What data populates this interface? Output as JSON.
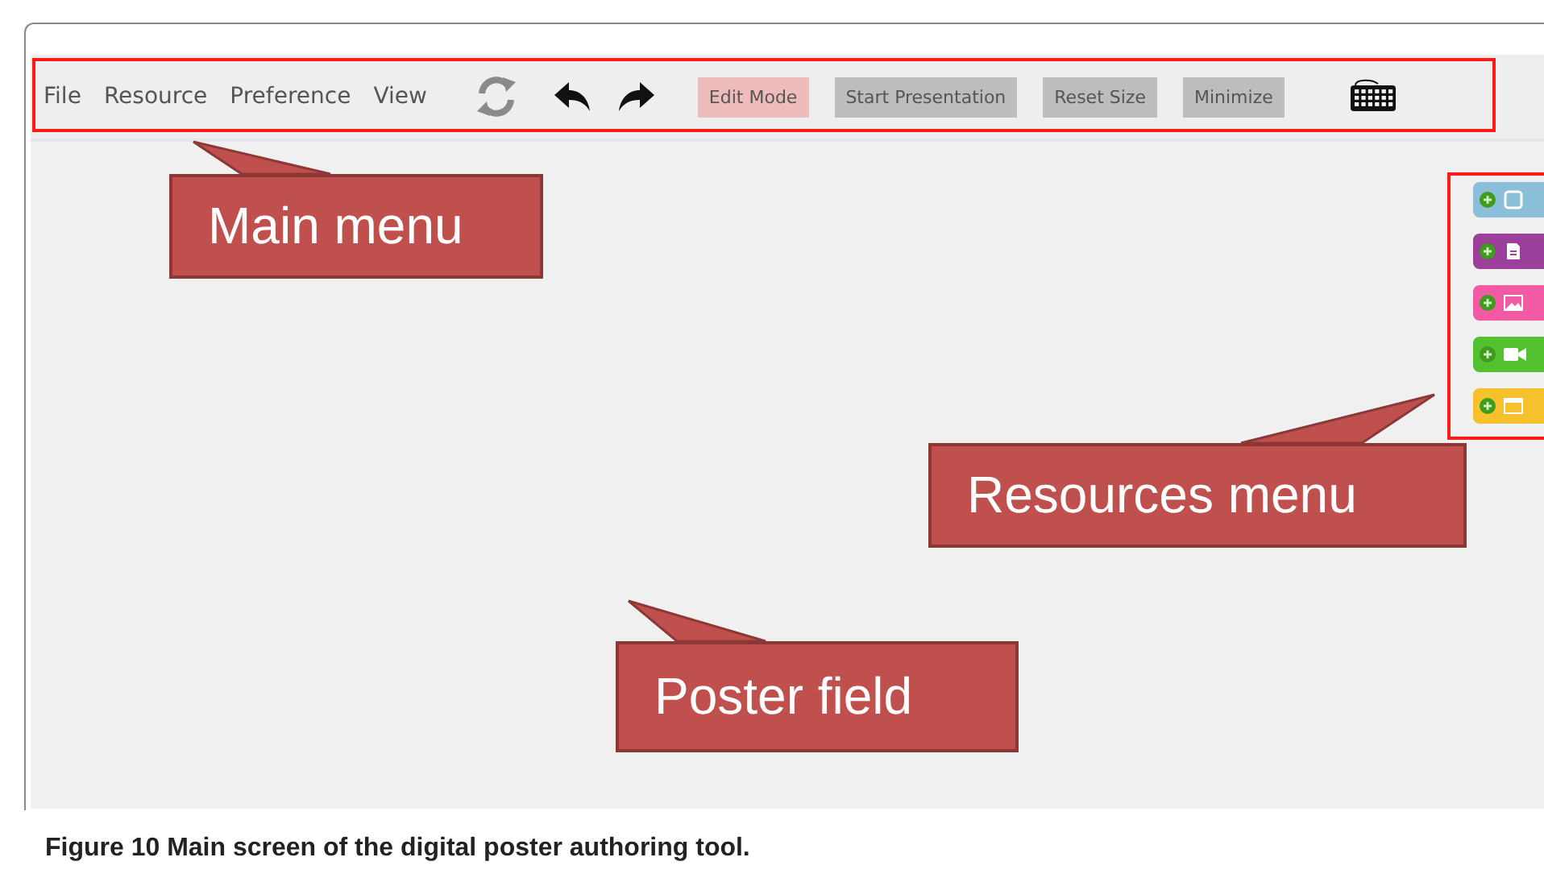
{
  "menu": [
    "File",
    "Resource",
    "Preference",
    "View"
  ],
  "toolbar_buttons": [
    {
      "label": "Edit Mode",
      "selected": true
    },
    {
      "label": "Start Presentation",
      "selected": false
    },
    {
      "label": "Reset Size",
      "selected": false
    },
    {
      "label": "Minimize",
      "selected": false
    }
  ],
  "resources": [
    {
      "kind": "shape",
      "color": "#8bbfd9"
    },
    {
      "kind": "text",
      "color": "#9b3f9a"
    },
    {
      "kind": "image",
      "color": "#f25aa4"
    },
    {
      "kind": "video",
      "color": "#53c12f"
    },
    {
      "kind": "frame",
      "color": "#f7c12e"
    }
  ],
  "callouts": [
    "Main menu",
    "Resources menu",
    "Poster field"
  ],
  "caption": "Figure 10 Main screen of the digital poster authoring tool."
}
